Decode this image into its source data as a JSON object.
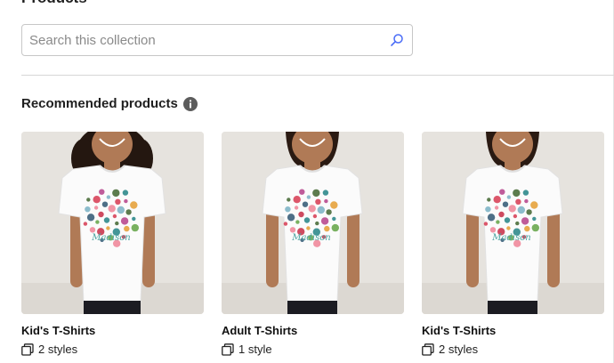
{
  "page": {
    "section_title": "Products"
  },
  "search": {
    "placeholder": "Search this collection",
    "value": ""
  },
  "recommended": {
    "title": "Recommended products",
    "products": [
      {
        "name": "Kid's T-Shirts",
        "styles": "2 styles",
        "model": "kid",
        "design_text": "Madison"
      },
      {
        "name": "Adult T-Shirts",
        "styles": "1 style",
        "model": "adult",
        "design_text": "Madison"
      },
      {
        "name": "Kid's T-Shirts",
        "styles": "2 styles",
        "model": "adult",
        "design_text": "Madison"
      }
    ]
  },
  "colors": {
    "border": "#c7c7c7",
    "divider": "#d6d6d6",
    "info_icon": "#5c5c5c",
    "search_icon": "#4a6cf7"
  }
}
